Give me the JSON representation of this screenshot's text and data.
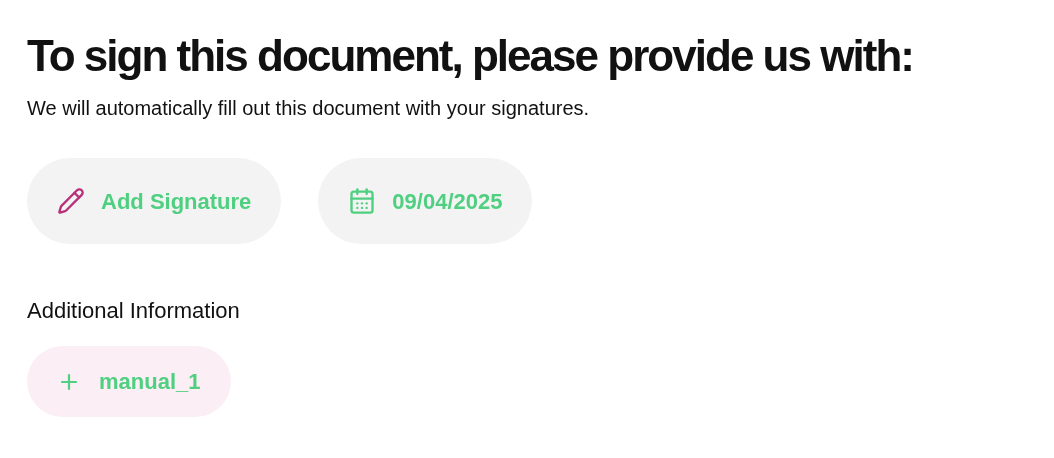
{
  "heading": "To sign this document, please provide us with:",
  "subtitle": "We will automatically fill out this document with your signatures.",
  "actions": [
    {
      "kind": "signature",
      "label": "Add Signature"
    },
    {
      "kind": "date",
      "label": "09/04/2025"
    }
  ],
  "additional": {
    "title": "Additional Information",
    "items": [
      {
        "label": "manual_1"
      }
    ]
  }
}
